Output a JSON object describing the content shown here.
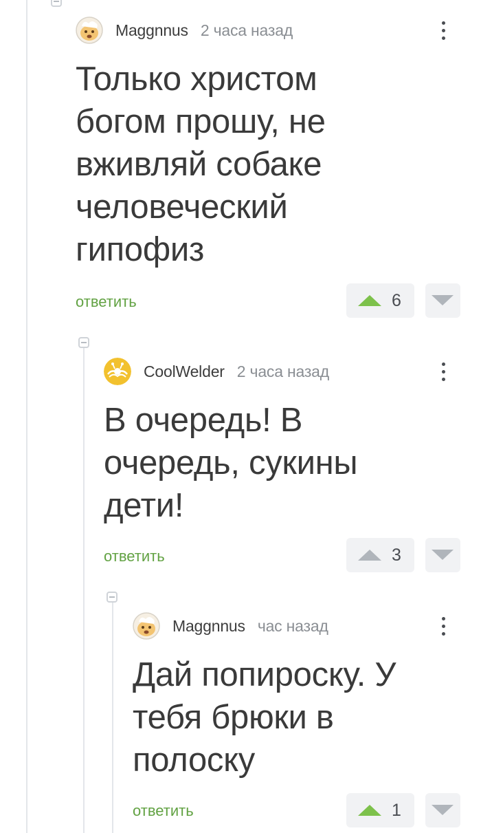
{
  "comments": [
    {
      "author": "Maggnnus",
      "time": "2 часа назад",
      "avatar_icon": "dog-avatar-icon",
      "text": "Только христом богом прошу, не вживляй собаке человеческий гипофиз",
      "reply_label": "ответить",
      "rating": "6",
      "upvoted": true
    },
    {
      "author": "CoolWelder",
      "time": "2 часа назад",
      "avatar_icon": "flying-spaghetti-monster-avatar-icon",
      "text": "В очередь! В очередь, сукины дети!",
      "reply_label": "ответить",
      "rating": "3",
      "upvoted": false
    },
    {
      "author": "Maggnnus",
      "time": "час назад",
      "avatar_icon": "dog-avatar-icon",
      "text": "Дай попироску. У тебя брюки в полоску",
      "reply_label": "ответить",
      "rating": "1",
      "upvoted": true
    }
  ],
  "colors": {
    "reply_link": "#62a243",
    "upvote_active": "#7dc14b",
    "vote_inactive": "#b0b5bb",
    "thread_line": "#e3e6ea"
  }
}
